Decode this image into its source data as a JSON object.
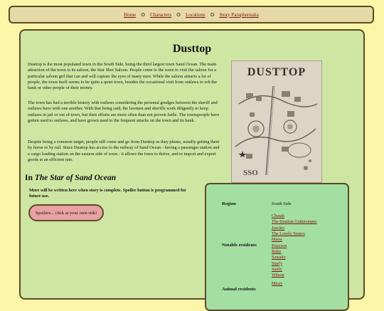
{
  "nav": {
    "items": [
      "Home",
      "Characters",
      "Locations",
      "Story Paraphernalia"
    ]
  },
  "page": {
    "title": "Dusttop",
    "paragraphs": [
      "Dusttop is the most populated town in the South Side, being the third largest town Sand Ocean. The main attraction of the town is its saloon, the Star Shot Saloon. People come to the town to visit the saloon for a particular saloon girl that can and will capture the eyes of many men. While the saloon attracts a lot of people, the town itself seems to be quite a quiet town, besides the occasional visit from outlaws to rob the bank or other people of their money.",
      "The town has had a terrible history with outlaws considering the personal grudges between the sheriff and outlaws have with one another. With that being said, the lawmen and sheriffs work diligently to keep outlaws in jail or out of town, but their efforts are more often than not proven futile. The townspeople have gotten used to outlaws, and have grown used to the frequent attacks on the town and its bank.",
      "Despite being a common target, people still come and go from Dusttop as they please, usually getting there by horse or by rail. Since Dusttop has access to the railway of Sand Ocean - having a passenger station and a cargo loading station on the eastern side of town - it allows the town to thrive, and to import and export goods at an efficient rate."
    ],
    "map": {
      "title": "DUSTTOP",
      "badge": "SSO"
    },
    "story_section": {
      "prefix": "In",
      "story_title": "The Star of Sand Ocean"
    },
    "story_note": "More will be written here when story is complete. Spoiler button is programmed for future use.",
    "spoiler_button": "Spoilers... click at your own risk!"
  },
  "infobox": {
    "region_label": "Region",
    "region_value": "South Side",
    "residents_label": "Notable residents",
    "residents": [
      "Chutah",
      "The Dustton Guttersnipes",
      "Jawiiro",
      "The Lovely Sisters",
      "Maria",
      "Peterson",
      "Ruby",
      "Sawako",
      "Starfy",
      "Starly",
      "Wilson"
    ],
    "animals_label": "Animal residents",
    "animals": [
      "Missy"
    ]
  },
  "colors": {
    "page_bg": "#fdf6a8",
    "panel_bg": "#cfe6a3",
    "infobox_bg": "#a3dfa3",
    "link": "#7a1010",
    "spoiler_bg": "#e8a2a2"
  }
}
